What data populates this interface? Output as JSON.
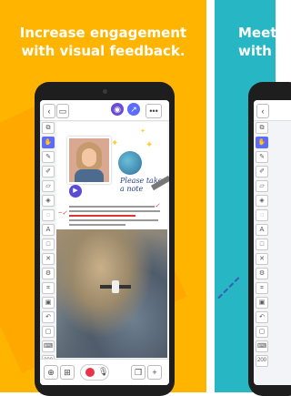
{
  "left_panel": {
    "headline_line1": "Increase engagement",
    "headline_line2": "with visual feedback.",
    "bg_color": "#ffb400"
  },
  "right_panel": {
    "headline_line1": "Meet",
    "headline_line2": "with",
    "bg_color": "#26b6c4"
  },
  "app": {
    "handwritten_note": "Please take a note",
    "tools": [
      "copy-icon",
      "hand-icon",
      "pen-icon",
      "pencil-icon",
      "eraser-icon",
      "fill-icon",
      "lasso-icon",
      "text-icon",
      "shapes-icon",
      "close-icon",
      "gear-icon",
      "crop-icon",
      "image-icon",
      "undo-icon",
      "cursor-icon",
      "keyboard-icon",
      "zoom-icon"
    ],
    "bottom_chip": "200"
  }
}
